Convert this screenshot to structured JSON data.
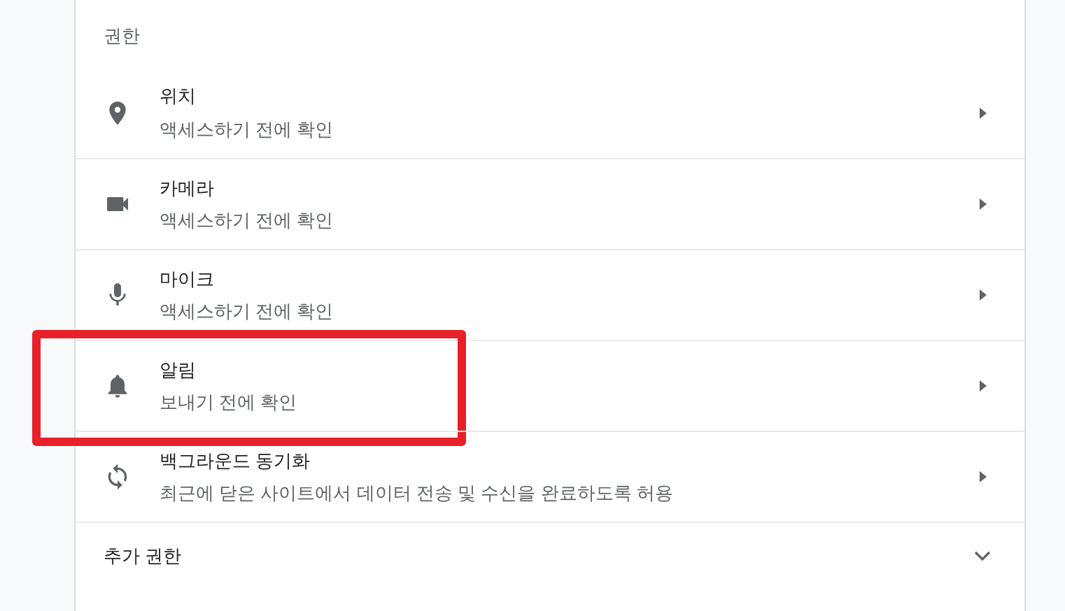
{
  "section_title": "권한",
  "permissions": [
    {
      "kind": "location",
      "title": "위치",
      "subtitle": "액세스하기 전에 확인",
      "highlighted": false
    },
    {
      "kind": "camera",
      "title": "카메라",
      "subtitle": "액세스하기 전에 확인",
      "highlighted": false
    },
    {
      "kind": "microphone",
      "title": "마이크",
      "subtitle": "액세스하기 전에 확인",
      "highlighted": false
    },
    {
      "kind": "bell",
      "title": "알림",
      "subtitle": "보내기 전에 확인",
      "highlighted": true
    },
    {
      "kind": "sync",
      "title": "백그라운드 동기화",
      "subtitle": "최근에 닫은 사이트에서 데이터 전송 및 수신을 완료하도록 허용",
      "highlighted": false
    }
  ],
  "additional": {
    "label": "추가 권한",
    "expanded": false
  }
}
